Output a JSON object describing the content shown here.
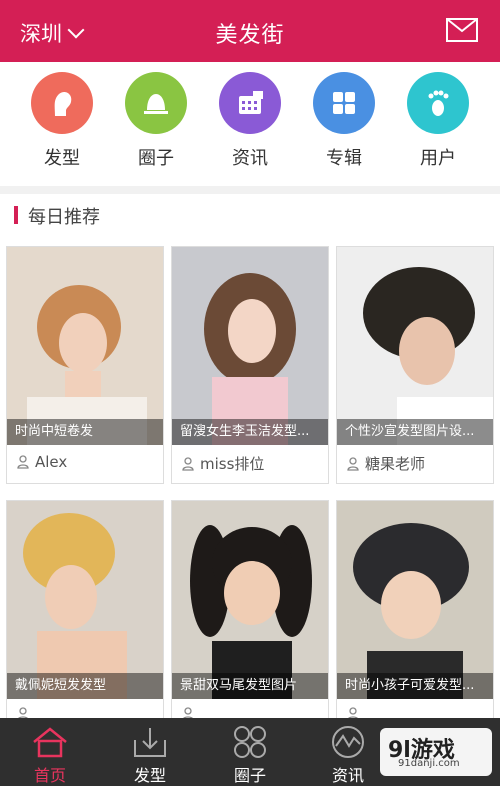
{
  "header": {
    "city": "深圳",
    "title": "美发街"
  },
  "categories": [
    {
      "label": "发型",
      "color": "#ef6b5c",
      "icon": "profile-head-icon"
    },
    {
      "label": "圈子",
      "color": "#8ac542",
      "icon": "bell-stand-icon"
    },
    {
      "label": "资讯",
      "color": "#8a5ad6",
      "icon": "grid-dots-icon"
    },
    {
      "label": "专辑",
      "color": "#4a90e2",
      "icon": "four-squares-icon"
    },
    {
      "label": "用户",
      "color": "#2ec5cf",
      "icon": "footprint-icon"
    }
  ],
  "section": {
    "title": "每日推荐"
  },
  "cards": [
    {
      "caption": "时尚中短卷发",
      "author": "Alex"
    },
    {
      "caption": "留溲女生李玉洁发型...",
      "author": "miss排位"
    },
    {
      "caption": "个性沙宣发型图片设...",
      "author": "糖果老师"
    },
    {
      "caption": "戴佩妮短发发型",
      "author": ""
    },
    {
      "caption": "景甜双马尾发型图片",
      "author": ""
    },
    {
      "caption": "时尚小孩子可爱发型...",
      "author": ""
    }
  ],
  "tabs": [
    {
      "label": "首页",
      "icon": "home-icon",
      "active": true
    },
    {
      "label": "发型",
      "icon": "download-tray-icon",
      "active": false
    },
    {
      "label": "圈子",
      "icon": "four-circles-icon",
      "active": false
    },
    {
      "label": "资讯",
      "icon": "activity-circle-icon",
      "active": false
    }
  ],
  "watermark": {
    "brand": "9l游戏",
    "site": "91danji.com"
  }
}
